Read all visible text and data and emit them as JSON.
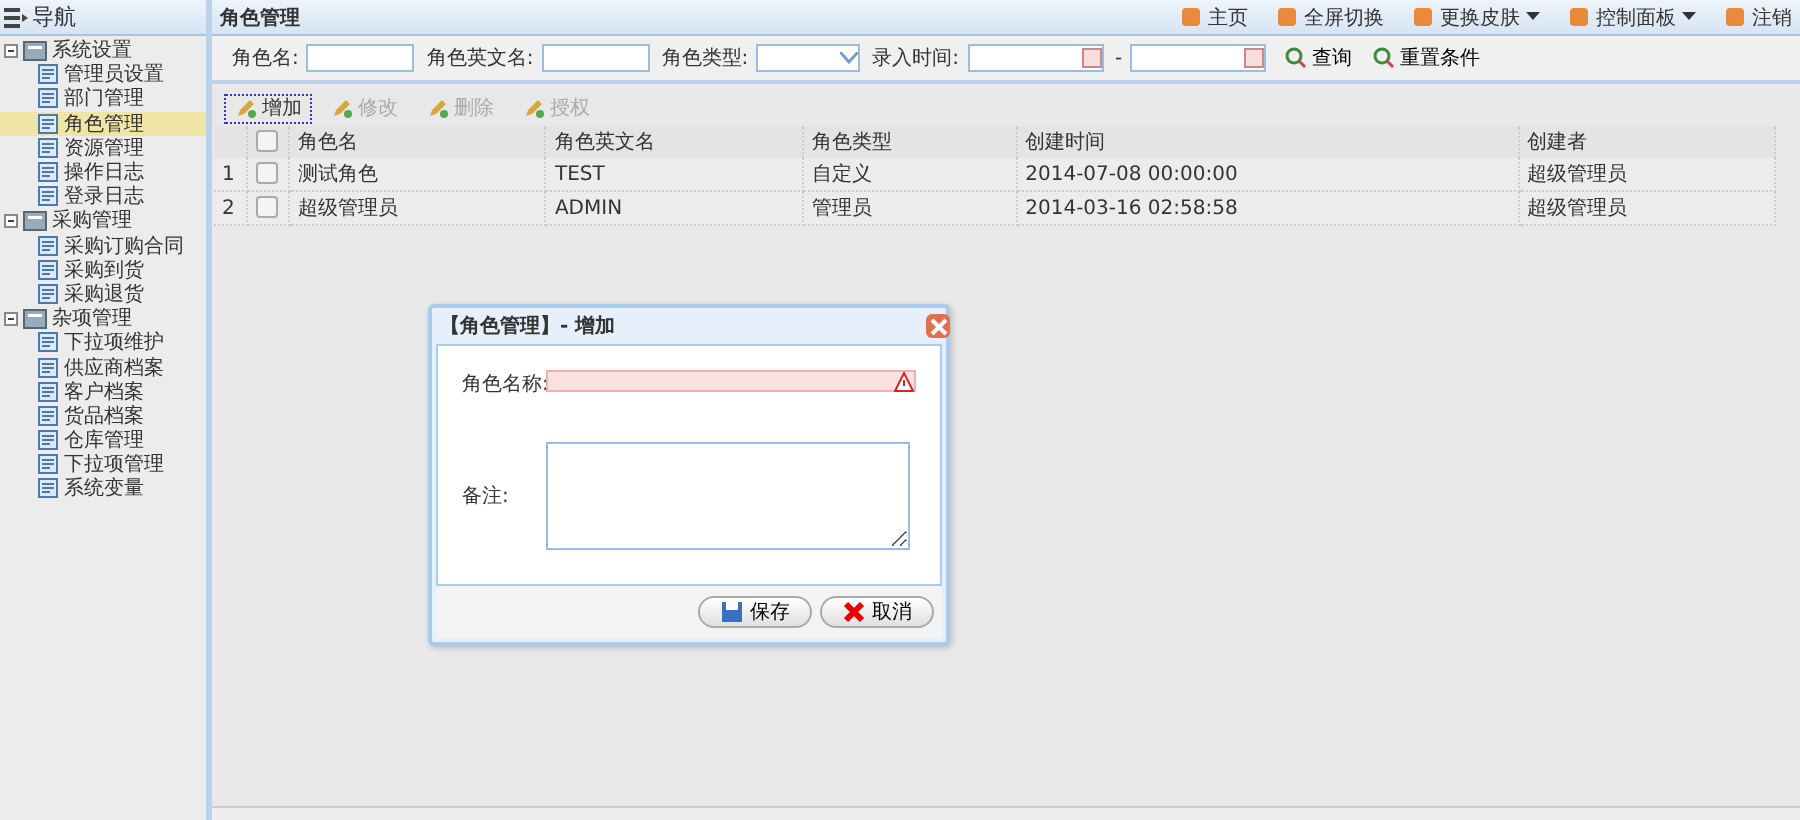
{
  "sidebar": {
    "title": "导航",
    "tree": [
      {
        "label": "系统设置",
        "expanded": true,
        "selected": false,
        "children": [
          {
            "label": "管理员设置",
            "selected": false
          },
          {
            "label": "部门管理",
            "selected": false
          },
          {
            "label": "角色管理",
            "selected": true
          },
          {
            "label": "资源管理",
            "selected": false
          },
          {
            "label": "操作日志",
            "selected": false
          },
          {
            "label": "登录日志",
            "selected": false
          }
        ]
      },
      {
        "label": "采购管理",
        "expanded": true,
        "selected": false,
        "children": [
          {
            "label": "采购订购合同",
            "selected": false
          },
          {
            "label": "采购到货",
            "selected": false
          },
          {
            "label": "采购退货",
            "selected": false
          }
        ]
      },
      {
        "label": "杂项管理",
        "expanded": true,
        "selected": false,
        "children": [
          {
            "label": "下拉项维护",
            "selected": false
          },
          {
            "label": "供应商档案",
            "selected": false
          },
          {
            "label": "客户档案",
            "selected": false
          },
          {
            "label": "货品档案",
            "selected": false
          },
          {
            "label": "仓库管理",
            "selected": false
          },
          {
            "label": "下拉项管理",
            "selected": false
          },
          {
            "label": "系统变量",
            "selected": false
          }
        ]
      }
    ]
  },
  "panel": {
    "title": "角色管理"
  },
  "top_links": [
    {
      "label": "主页",
      "menu": false
    },
    {
      "label": "全屏切换",
      "menu": false
    },
    {
      "label": "更换皮肤",
      "menu": true
    },
    {
      "label": "控制面板",
      "menu": true
    },
    {
      "label": "注销",
      "menu": false
    }
  ],
  "search": {
    "fields": [
      {
        "kind": "text",
        "label": "角色名:"
      },
      {
        "kind": "text",
        "label": "角色英文名:"
      },
      {
        "kind": "select",
        "label": "角色类型:"
      },
      {
        "kind": "daterange",
        "label": "录入时间:",
        "separator": "-"
      }
    ],
    "buttons": [
      "查询",
      "重置条件"
    ]
  },
  "toolbar": [
    {
      "label": "增加",
      "disabled": false
    },
    {
      "label": "修改",
      "disabled": true
    },
    {
      "label": "删除",
      "disabled": true
    },
    {
      "label": "授权",
      "disabled": true
    }
  ],
  "table": {
    "all_checked": false,
    "columns": [
      "角色名",
      "角色英文名",
      "角色类型",
      "创建时间",
      "创建者"
    ],
    "rows": [
      {
        "number": "1",
        "checked": false,
        "cells": [
          "测试角色",
          "TEST",
          "自定义",
          "2014-07-08 00:00:00",
          "超级管理员"
        ]
      },
      {
        "number": "2",
        "checked": false,
        "cells": [
          "超级管理员",
          "ADMIN",
          "管理员",
          "2014-03-16 02:58:58",
          "超级管理员"
        ]
      }
    ]
  },
  "dialog": {
    "title": "【角色管理】- 增加",
    "fields": [
      {
        "kind": "input",
        "label": "角色名称:",
        "invalid": true
      },
      {
        "kind": "textarea",
        "label": "备注:",
        "invalid": false
      }
    ],
    "buttons": [
      {
        "kind": "save",
        "label": "保存"
      },
      {
        "kind": "cancel",
        "label": "取消"
      }
    ]
  }
}
